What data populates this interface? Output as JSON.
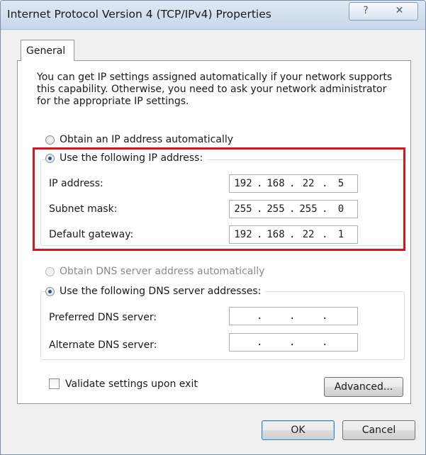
{
  "window": {
    "title": "Internet Protocol Version 4 (TCP/IPv4) Properties",
    "help_glyph": "?",
    "close_glyph": "✕"
  },
  "tabs": [
    {
      "label": "General",
      "selected": true
    }
  ],
  "description": "You can get IP settings assigned automatically if your network supports this capability. Otherwise, you need to ask your network administrator for the appropriate IP settings.",
  "ip_section": {
    "auto_label": "Obtain an IP address automatically",
    "auto_selected": false,
    "manual_label": "Use the following IP address:",
    "manual_selected": true,
    "highlight_color": "#d9161c",
    "fields": [
      {
        "label": "IP address:",
        "octets": [
          "192",
          "168",
          "22",
          "5"
        ]
      },
      {
        "label": "Subnet mask:",
        "octets": [
          "255",
          "255",
          "255",
          "0"
        ]
      },
      {
        "label": "Default gateway:",
        "octets": [
          "192",
          "168",
          "22",
          "1"
        ]
      }
    ]
  },
  "dns_section": {
    "auto_label": "Obtain DNS server address automatically",
    "auto_enabled": false,
    "manual_label": "Use the following DNS server addresses:",
    "manual_selected": true,
    "fields": [
      {
        "label": "Preferred DNS server:",
        "octets": [
          "",
          "",
          "",
          ""
        ]
      },
      {
        "label": "Alternate DNS server:",
        "octets": [
          "",
          "",
          "",
          ""
        ]
      }
    ]
  },
  "validate": {
    "label": "Validate settings upon exit",
    "checked": false
  },
  "buttons": {
    "advanced": "Advanced...",
    "ok": "OK",
    "cancel": "Cancel"
  },
  "ip_separator": "."
}
